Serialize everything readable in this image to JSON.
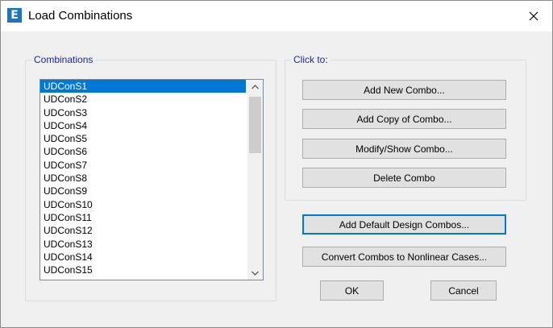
{
  "window": {
    "title": "Load Combinations",
    "app_icon_letter": "E"
  },
  "combinations": {
    "legend": "Combinations",
    "selected_index": 0,
    "items": [
      "UDConS1",
      "UDConS2",
      "UDConS3",
      "UDConS4",
      "UDConS5",
      "UDConS6",
      "UDConS7",
      "UDConS8",
      "UDConS9",
      "UDConS10",
      "UDConS11",
      "UDConS12",
      "UDConS13",
      "UDConS14",
      "UDConS15"
    ]
  },
  "click_to": {
    "legend": "Click to:",
    "add_new": "Add New Combo...",
    "add_copy": "Add Copy of Combo...",
    "modify_show": "Modify/Show Combo...",
    "delete": "Delete Combo"
  },
  "actions": {
    "add_default": "Add Default Design Combos...",
    "convert": "Convert Combos to Nonlinear Cases...",
    "ok": "OK",
    "cancel": "Cancel"
  },
  "colors": {
    "selection": "#0078d7",
    "legend_text": "#2323a0",
    "app_icon": "#1e73be"
  },
  "icons": {
    "app": "etabs-app-icon",
    "close": "close-icon",
    "scroll_up": "chevron-up-icon",
    "scroll_down": "chevron-down-icon"
  }
}
